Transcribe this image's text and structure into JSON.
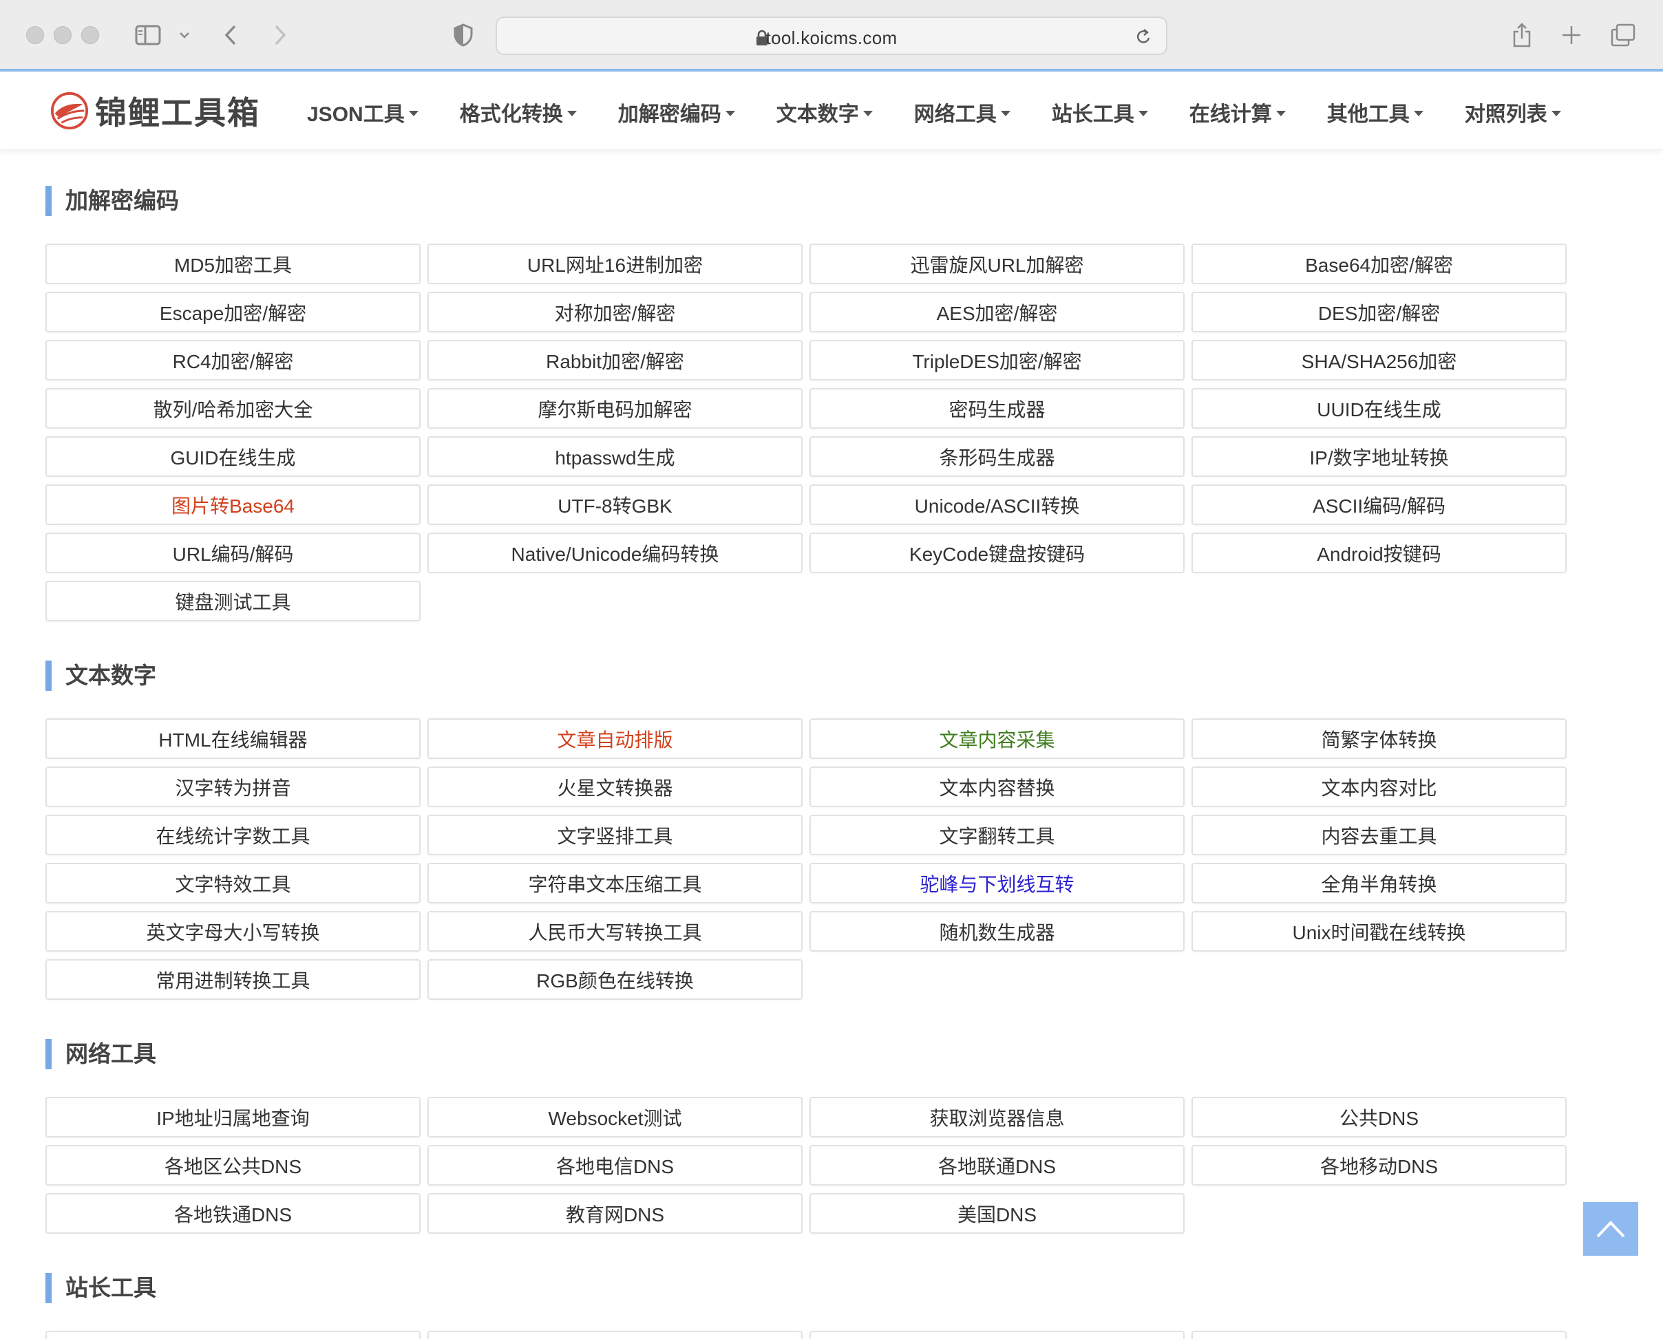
{
  "browser": {
    "url": "tool.koicms.com"
  },
  "site": {
    "logo_text": "锦鲤工具箱",
    "brand_color": "#d4493a",
    "nav": [
      {
        "label": "JSON工具"
      },
      {
        "label": "格式化转换"
      },
      {
        "label": "加解密编码"
      },
      {
        "label": "文本数字"
      },
      {
        "label": "网络工具"
      },
      {
        "label": "站长工具"
      },
      {
        "label": "在线计算"
      },
      {
        "label": "其他工具"
      },
      {
        "label": "对照列表"
      }
    ]
  },
  "sections": [
    {
      "title": "加解密编码",
      "tools": [
        {
          "label": "MD5加密工具"
        },
        {
          "label": "URL网址16进制加密"
        },
        {
          "label": "迅雷旋风URL加解密"
        },
        {
          "label": "Base64加密/解密"
        },
        {
          "label": "Escape加密/解密"
        },
        {
          "label": "对称加密/解密"
        },
        {
          "label": "AES加密/解密"
        },
        {
          "label": "DES加密/解密"
        },
        {
          "label": "RC4加密/解密"
        },
        {
          "label": "Rabbit加密/解密"
        },
        {
          "label": "TripleDES加密/解密"
        },
        {
          "label": "SHA/SHA256加密"
        },
        {
          "label": "散列/哈希加密大全"
        },
        {
          "label": "摩尔斯电码加解密"
        },
        {
          "label": "密码生成器"
        },
        {
          "label": "UUID在线生成"
        },
        {
          "label": "GUID在线生成"
        },
        {
          "label": "htpasswd生成"
        },
        {
          "label": "条形码生成器"
        },
        {
          "label": "IP/数字地址转换"
        },
        {
          "label": "图片转Base64",
          "color": "#d4401c"
        },
        {
          "label": "UTF-8转GBK"
        },
        {
          "label": "Unicode/ASCII转换"
        },
        {
          "label": "ASCII编码/解码"
        },
        {
          "label": "URL编码/解码"
        },
        {
          "label": "Native/Unicode编码转换"
        },
        {
          "label": "KeyCode键盘按键码"
        },
        {
          "label": "Android按键码"
        },
        {
          "label": "键盘测试工具"
        }
      ]
    },
    {
      "title": "文本数字",
      "tools": [
        {
          "label": "HTML在线编辑器"
        },
        {
          "label": "文章自动排版",
          "color": "#d4401c"
        },
        {
          "label": "文章内容采集",
          "color": "#3e7d1c"
        },
        {
          "label": "简繁字体转换"
        },
        {
          "label": "汉字转为拼音"
        },
        {
          "label": "火星文转换器"
        },
        {
          "label": "文本内容替换"
        },
        {
          "label": "文本内容对比"
        },
        {
          "label": "在线统计字数工具"
        },
        {
          "label": "文字竖排工具"
        },
        {
          "label": "文字翻转工具"
        },
        {
          "label": "内容去重工具"
        },
        {
          "label": "文字特效工具"
        },
        {
          "label": "字符串文本压缩工具"
        },
        {
          "label": "驼峰与下划线互转",
          "color": "#2a1fd0"
        },
        {
          "label": "全角半角转换"
        },
        {
          "label": "英文字母大小写转换"
        },
        {
          "label": "人民币大写转换工具"
        },
        {
          "label": "随机数生成器"
        },
        {
          "label": "Unix时间戳在线转换"
        },
        {
          "label": "常用进制转换工具"
        },
        {
          "label": "RGB颜色在线转换"
        }
      ]
    },
    {
      "title": "网络工具",
      "tools": [
        {
          "label": "IP地址归属地查询"
        },
        {
          "label": "Websocket测试"
        },
        {
          "label": "获取浏览器信息"
        },
        {
          "label": "公共DNS"
        },
        {
          "label": "各地区公共DNS"
        },
        {
          "label": "各地电信DNS"
        },
        {
          "label": "各地联通DNS"
        },
        {
          "label": "各地移动DNS"
        },
        {
          "label": "各地铁通DNS"
        },
        {
          "label": "教育网DNS"
        },
        {
          "label": "美国DNS"
        }
      ]
    },
    {
      "title": "站长工具",
      "tools": [
        {
          "label": ""
        },
        {
          "label": ""
        },
        {
          "label": ""
        },
        {
          "label": ""
        }
      ]
    }
  ]
}
